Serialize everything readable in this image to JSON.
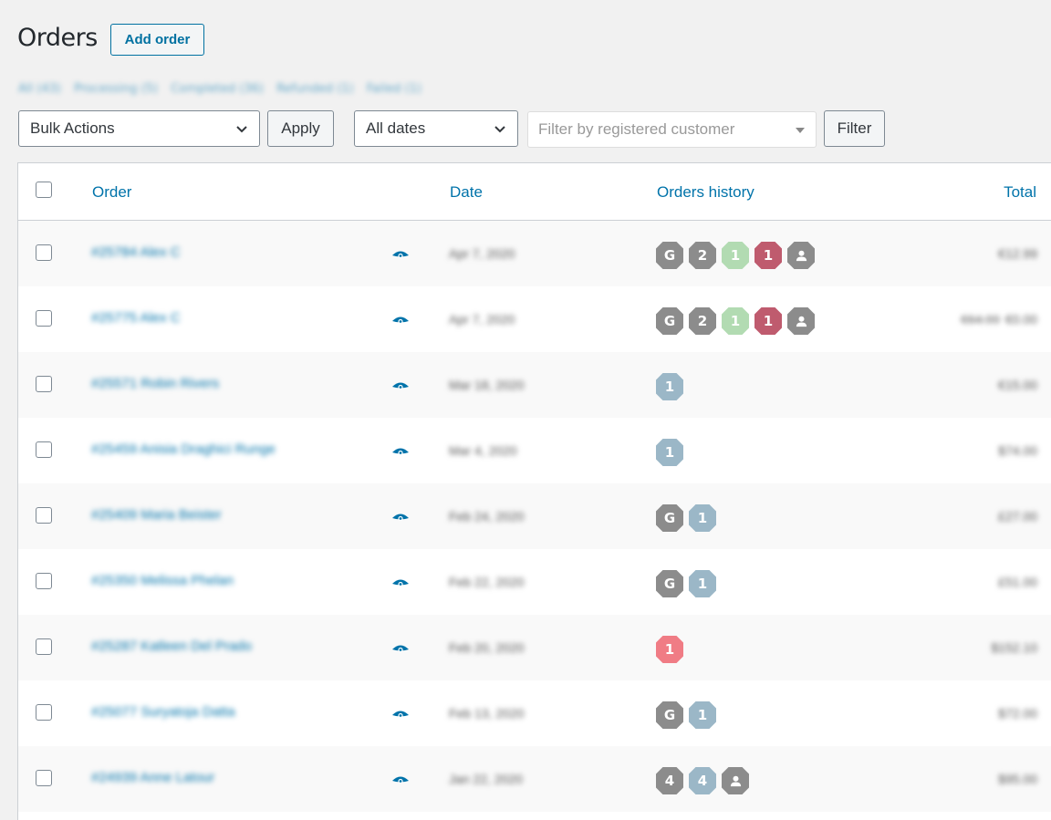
{
  "page": {
    "title": "Orders",
    "add_order_label": "Add order"
  },
  "status_links": [
    "All (43)",
    "Processing (5)",
    "Completed (36)",
    "Refunded (1)",
    "Failed (1)"
  ],
  "filters": {
    "bulk_actions": "Bulk Actions",
    "apply_label": "Apply",
    "dates": "All dates",
    "customer_placeholder": "Filter by registered customer",
    "filter_label": "Filter"
  },
  "table": {
    "columns": {
      "order": "Order",
      "date": "Date",
      "history": "Orders history",
      "total": "Total"
    },
    "rows": [
      {
        "order": "#25784 Alex C",
        "date": "Apr 7, 2020",
        "total": "€12.99",
        "total_old": "",
        "badges": [
          {
            "text": "G",
            "color": "#8c8c8c"
          },
          {
            "text": "2",
            "color": "#8c8c8c"
          },
          {
            "text": "1",
            "color": "#b2dbb2"
          },
          {
            "text": "1",
            "color": "#bf5b6e"
          },
          {
            "text": "user",
            "color": "#8c8c8c",
            "icon": true
          }
        ]
      },
      {
        "order": "#25775 Alex C",
        "date": "Apr 7, 2020",
        "total": "€0.00",
        "total_old": "€64.99",
        "badges": [
          {
            "text": "G",
            "color": "#8c8c8c"
          },
          {
            "text": "2",
            "color": "#8c8c8c"
          },
          {
            "text": "1",
            "color": "#b2dbb2"
          },
          {
            "text": "1",
            "color": "#bf5b6e"
          },
          {
            "text": "user",
            "color": "#8c8c8c",
            "icon": true
          }
        ]
      },
      {
        "order": "#25571 Robin Rivers",
        "date": "Mar 18, 2020",
        "total": "€15.00",
        "total_old": "",
        "badges": [
          {
            "text": "1",
            "color": "#9bb7c7"
          }
        ]
      },
      {
        "order": "#25459 Anisia Draghici Runge",
        "date": "Mar 4, 2020",
        "total": "$74.00",
        "total_old": "",
        "badges": [
          {
            "text": "1",
            "color": "#9bb7c7"
          }
        ]
      },
      {
        "order": "#25409 Maria Beister",
        "date": "Feb 24, 2020",
        "total": "£27.00",
        "total_old": "",
        "badges": [
          {
            "text": "G",
            "color": "#8c8c8c"
          },
          {
            "text": "1",
            "color": "#9bb7c7"
          }
        ]
      },
      {
        "order": "#25350 Melissa Phelan",
        "date": "Feb 22, 2020",
        "total": "£51.00",
        "total_old": "",
        "badges": [
          {
            "text": "G",
            "color": "#8c8c8c"
          },
          {
            "text": "1",
            "color": "#9bb7c7"
          }
        ]
      },
      {
        "order": "#25287 Katleen Del Prado",
        "date": "Feb 20, 2020",
        "total": "$152.10",
        "total_old": "",
        "badges": [
          {
            "text": "1",
            "color": "#f07c85"
          }
        ]
      },
      {
        "order": "#25077 Suryatoja Datta",
        "date": "Feb 13, 2020",
        "total": "$72.00",
        "total_old": "",
        "badges": [
          {
            "text": "G",
            "color": "#8c8c8c"
          },
          {
            "text": "1",
            "color": "#9bb7c7"
          }
        ]
      },
      {
        "order": "#24939 Anne Latour",
        "date": "Jan 22, 2020",
        "total": "$95.00",
        "total_old": "",
        "badges": [
          {
            "text": "4",
            "color": "#8c8c8c"
          },
          {
            "text": "4",
            "color": "#9bb7c7"
          },
          {
            "text": "user",
            "color": "#8c8c8c",
            "icon": true
          }
        ]
      }
    ]
  },
  "colors": {
    "link": "#0073aa",
    "eye": "#0073aa"
  },
  "icons": {
    "view": "eye-icon",
    "customer": "user-icon",
    "dropdown": "chevron-down-icon"
  }
}
